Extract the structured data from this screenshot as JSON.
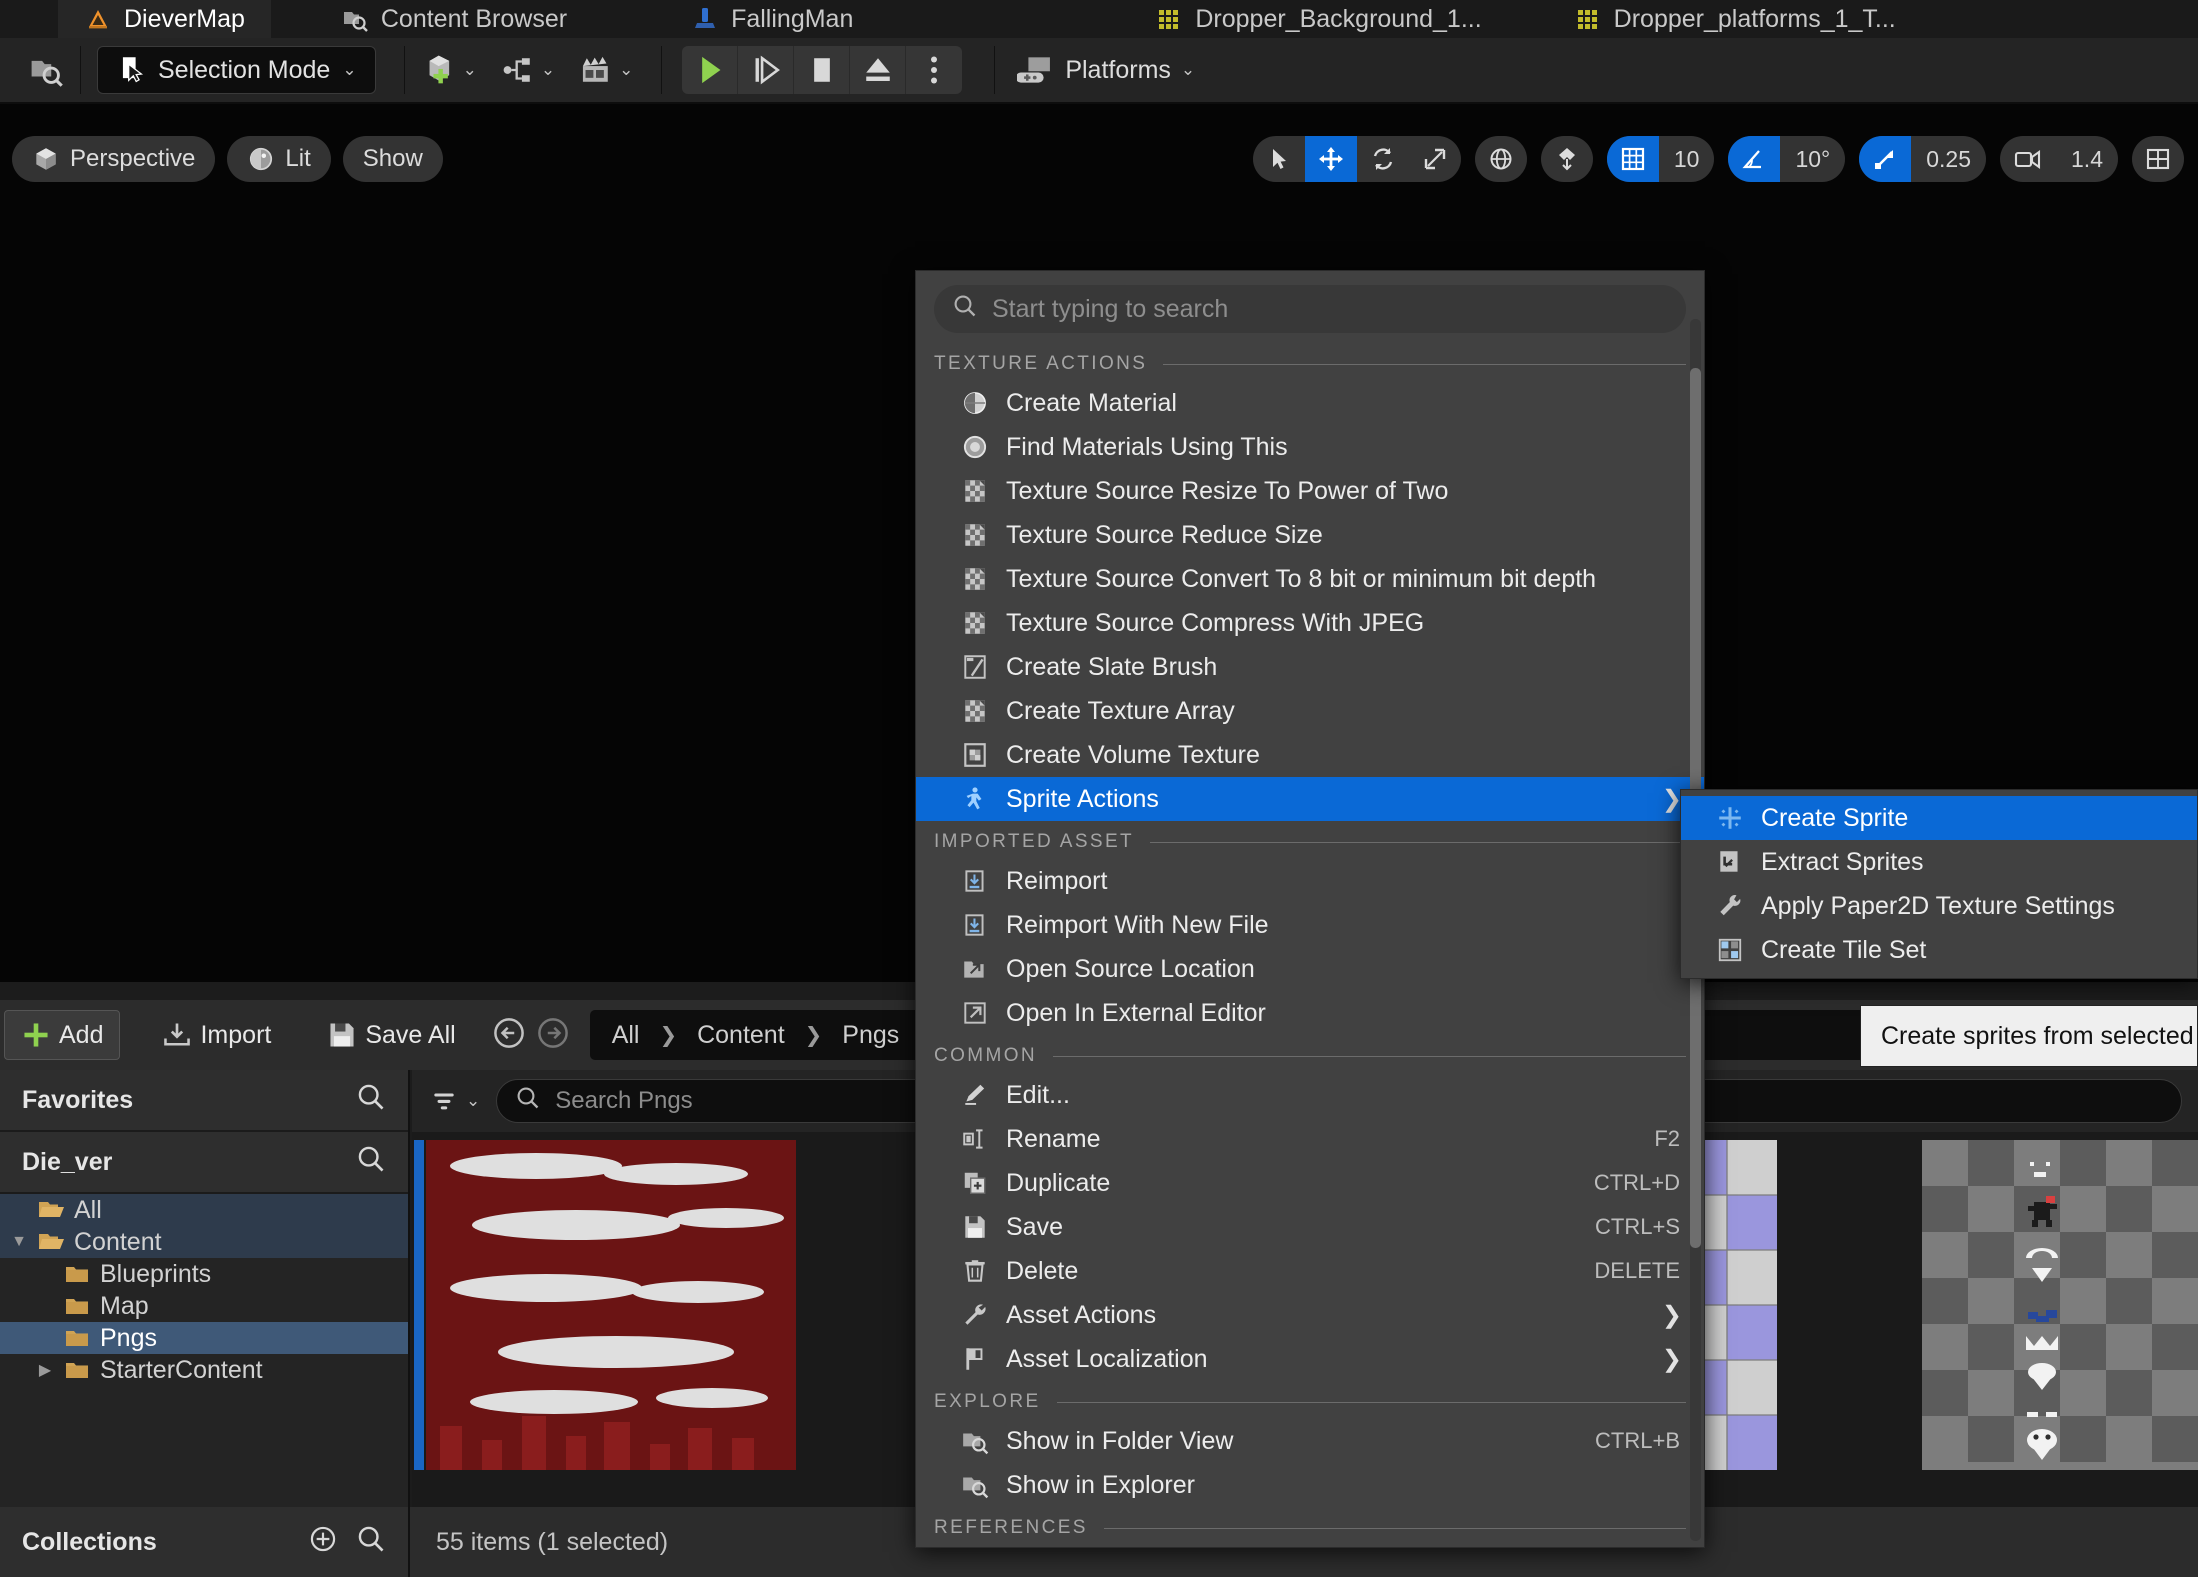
{
  "tabs": [
    {
      "label": "DieverMap",
      "icon": "unreal-map-icon",
      "active": true
    },
    {
      "label": "Content Browser",
      "icon": "content-browser-icon",
      "active": false
    },
    {
      "label": "FallingMan",
      "icon": "blueprint-actor-icon",
      "active": false
    },
    {
      "label": "Dropper_Background_1...",
      "icon": "texture-icon",
      "active": false
    },
    {
      "label": "Dropper_platforms_1_T...",
      "icon": "texture-icon",
      "active": false
    }
  ],
  "toolbar": {
    "content_browser_icon": "content-browser-icon",
    "selection_mode": "Selection Mode",
    "quick_add_icon": "add-actor-icon",
    "blueprints_icon": "blueprints-icon",
    "cinematics_icon": "cinematics-icon",
    "play_icon": "play-icon",
    "skip_icon": "step-icon",
    "stop_icon": "stop-icon",
    "eject_icon": "eject-icon",
    "more_icon": "more-options-icon",
    "platforms": "Platforms"
  },
  "viewport": {
    "perspective": "Perspective",
    "lit": "Lit",
    "show": "Show",
    "select_icon": "cursor-select-icon",
    "translate_icon": "translate-gizmo-icon",
    "rotate_icon": "rotate-gizmo-icon",
    "scale_icon": "scale-gizmo-icon",
    "world_icon": "world-coordinate-icon",
    "surface_snap_icon": "surface-snap-icon",
    "grid_snap_icon": "grid-snap-icon",
    "grid_snap_value": "10",
    "angle_snap_icon": "angle-snap-icon",
    "angle_snap_value": "10°",
    "scale_snap_icon": "scale-snap-icon",
    "scale_snap_value": "0.25",
    "camera_speed_icon": "camera-speed-icon",
    "camera_speed_value": "1.4",
    "layout_icon": "viewport-layout-icon"
  },
  "content_browser": {
    "add_label": "Add",
    "import_label": "Import",
    "save_all_label": "Save All",
    "back_icon": "back-arrow-icon",
    "forward_icon": "forward-arrow-icon",
    "breadcrumbs": [
      "All",
      "Content",
      "Pngs"
    ],
    "filter_icon": "filter-icon",
    "search_placeholder": "Search Pngs",
    "search_value": "",
    "favorites_label": "Favorites",
    "project_label": "Die_ver",
    "collections_label": "Collections",
    "item_count": "55 items (1 selected)",
    "tree": [
      {
        "label": "All",
        "depth": 0,
        "state": "soft",
        "twisty": ""
      },
      {
        "label": "Content",
        "depth": 0,
        "state": "soft",
        "twisty": "down"
      },
      {
        "label": "Blueprints",
        "depth": 1,
        "state": "none",
        "twisty": ""
      },
      {
        "label": "Map",
        "depth": 1,
        "state": "none",
        "twisty": ""
      },
      {
        "label": "Pngs",
        "depth": 1,
        "state": "strong",
        "twisty": ""
      },
      {
        "label": "StarterContent",
        "depth": 1,
        "state": "none",
        "twisty": "right"
      }
    ]
  },
  "context_menu": {
    "search_placeholder": "Start typing to search",
    "sections": [
      {
        "title": "TEXTURE ACTIONS",
        "items": [
          {
            "label": "Create Material",
            "icon": "material-sphere-icon",
            "shortcut": "",
            "submenu": false,
            "highlight": false
          },
          {
            "label": "Find Materials Using This",
            "icon": "find-material-icon",
            "shortcut": "",
            "submenu": false,
            "highlight": false
          },
          {
            "label": "Texture Source Resize To Power of Two",
            "icon": "texture-checker-icon",
            "shortcut": "",
            "submenu": false,
            "highlight": false
          },
          {
            "label": "Texture Source Reduce Size",
            "icon": "texture-checker-icon",
            "shortcut": "",
            "submenu": false,
            "highlight": false
          },
          {
            "label": "Texture Source Convert To 8 bit or minimum bit depth",
            "icon": "texture-checker-icon",
            "shortcut": "",
            "submenu": false,
            "highlight": false
          },
          {
            "label": "Texture Source Compress With JPEG",
            "icon": "texture-checker-icon",
            "shortcut": "",
            "submenu": false,
            "highlight": false
          },
          {
            "label": "Create Slate Brush",
            "icon": "slate-brush-icon",
            "shortcut": "",
            "submenu": false,
            "highlight": false
          },
          {
            "label": "Create Texture Array",
            "icon": "texture-checker-icon",
            "shortcut": "",
            "submenu": false,
            "highlight": false
          },
          {
            "label": "Create Volume Texture",
            "icon": "volume-texture-icon",
            "shortcut": "",
            "submenu": false,
            "highlight": false
          },
          {
            "label": "Sprite Actions",
            "icon": "sprite-actions-icon",
            "shortcut": "",
            "submenu": true,
            "highlight": true
          }
        ]
      },
      {
        "title": "IMPORTED ASSET",
        "items": [
          {
            "label": "Reimport",
            "icon": "reimport-icon",
            "shortcut": "",
            "submenu": false,
            "highlight": false
          },
          {
            "label": "Reimport With New File",
            "icon": "reimport-icon",
            "shortcut": "",
            "submenu": false,
            "highlight": false
          },
          {
            "label": "Open Source Location",
            "icon": "open-folder-icon",
            "shortcut": "",
            "submenu": false,
            "highlight": false
          },
          {
            "label": "Open In External Editor",
            "icon": "external-editor-icon",
            "shortcut": "",
            "submenu": false,
            "highlight": false
          }
        ]
      },
      {
        "title": "COMMON",
        "items": [
          {
            "label": "Edit...",
            "icon": "edit-pencil-icon",
            "shortcut": "",
            "submenu": false,
            "highlight": false
          },
          {
            "label": "Rename",
            "icon": "rename-icon",
            "shortcut": "F2",
            "submenu": false,
            "highlight": false
          },
          {
            "label": "Duplicate",
            "icon": "duplicate-icon",
            "shortcut": "CTRL+D",
            "submenu": false,
            "highlight": false
          },
          {
            "label": "Save",
            "icon": "save-disk-icon",
            "shortcut": "CTRL+S",
            "submenu": false,
            "highlight": false
          },
          {
            "label": "Delete",
            "icon": "trash-icon",
            "shortcut": "DELETE",
            "submenu": false,
            "highlight": false
          },
          {
            "label": "Asset Actions",
            "icon": "wrench-icon",
            "shortcut": "",
            "submenu": true,
            "highlight": false
          },
          {
            "label": "Asset Localization",
            "icon": "flag-icon",
            "shortcut": "",
            "submenu": true,
            "highlight": false
          }
        ]
      },
      {
        "title": "EXPLORE",
        "items": [
          {
            "label": "Show in Folder View",
            "icon": "folder-search-icon",
            "shortcut": "CTRL+B",
            "submenu": false,
            "highlight": false
          },
          {
            "label": "Show in Explorer",
            "icon": "folder-search-icon",
            "shortcut": "",
            "submenu": false,
            "highlight": false
          }
        ]
      },
      {
        "title": "REFERENCES",
        "items": []
      }
    ]
  },
  "submenu": {
    "items": [
      {
        "label": "Create Sprite",
        "icon": "create-sprite-icon",
        "highlight": true
      },
      {
        "label": "Extract Sprites",
        "icon": "extract-sprites-icon",
        "highlight": false
      },
      {
        "label": "Apply Paper2D Texture Settings",
        "icon": "paper2d-wrench-icon",
        "highlight": false
      },
      {
        "label": "Create Tile Set",
        "icon": "tile-set-icon",
        "highlight": false
      }
    ]
  },
  "tooltip": {
    "text": "Create sprites from selected t"
  },
  "colors": {
    "accent_blue": "#0a69d6",
    "folder_gold": "#d0a354",
    "play_green": "#8fd14f",
    "menu_bg": "#414141",
    "tooltip_bg": "#efefef"
  }
}
